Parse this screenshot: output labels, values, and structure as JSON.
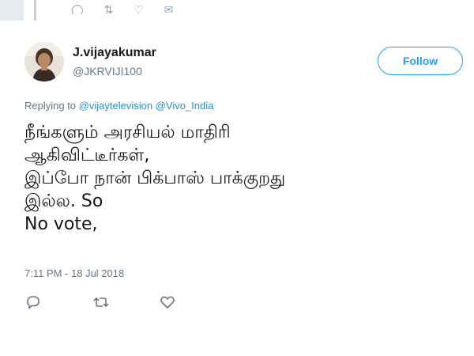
{
  "previous_tweet": {
    "action_icons": [
      "reply-icon",
      "retweet-icon",
      "like-icon",
      "share-icon"
    ]
  },
  "author": {
    "name": "J.vijayakumar",
    "handle": "@JKRVIJI100",
    "avatar_icon": "avatar-photo"
  },
  "follow_button": {
    "label": "Follow",
    "color": "#1da1f2"
  },
  "replying_to": {
    "prefix": "Replying to",
    "mentions": [
      "@vijaytelevision",
      "@Vivo_India"
    ],
    "mention_color": "#1b95e0"
  },
  "tweet": {
    "lines": [
      "நீங்களும் அரசியல் மாதிரி",
      "ஆகிவிட்டீர்கள்,",
      "இப்போ நான் பிக்பாஸ் பாக்குறது",
      "இல்ல. So",
      "No vote,"
    ],
    "timestamp": "7:11 PM - 18 Jul 2018"
  },
  "actions": {
    "icons": [
      "reply-icon",
      "retweet-icon",
      "like-icon"
    ],
    "icon_color": "#657786"
  }
}
